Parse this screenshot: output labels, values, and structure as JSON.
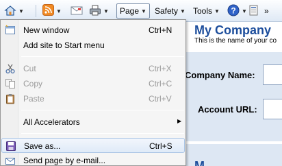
{
  "toolbar": {
    "page_label": "Page",
    "safety_label": "Safety",
    "tools_label": "Tools"
  },
  "webpage": {
    "company_title": "My Company",
    "company_subtitle": "This is the name of your co",
    "company_name_label": "Company Name:",
    "account_url_label": "Account URL:",
    "bottom_title": "M"
  },
  "menu": {
    "new_window": {
      "label": "New window",
      "shortcut": "Ctrl+N"
    },
    "add_site": {
      "label": "Add site to Start menu"
    },
    "cut": {
      "label": "Cut",
      "shortcut": "Ctrl+X"
    },
    "copy": {
      "label": "Copy",
      "shortcut": "Ctrl+C"
    },
    "paste": {
      "label": "Paste",
      "shortcut": "Ctrl+V"
    },
    "all_accelerators": {
      "label": "All Accelerators"
    },
    "save_as": {
      "label": "Save as...",
      "shortcut": "Ctrl+S"
    },
    "send_page": {
      "label": "Send page by e-mail..."
    }
  }
}
